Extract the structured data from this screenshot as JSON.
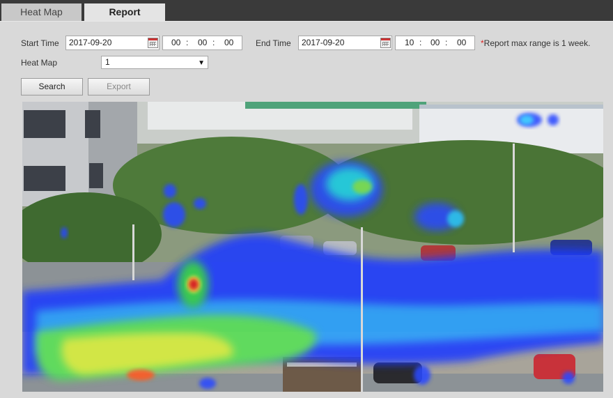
{
  "tabs": [
    {
      "label": "Heat Map",
      "active": false
    },
    {
      "label": "Report",
      "active": true
    }
  ],
  "form": {
    "start_time_label": "Start Time",
    "start_date": "2017-09-20",
    "start_hour": "00",
    "start_min": "00",
    "start_sec": "00",
    "end_time_label": "End Time",
    "end_date": "2017-09-20",
    "end_hour": "10",
    "end_min": "00",
    "end_sec": "00",
    "time_sep": ":",
    "note_star": "*",
    "note_text": "Report max range is 1 week.",
    "heatmap_label": "Heat Map",
    "heatmap_value": "1",
    "search_label": "Search",
    "export_label": "Export"
  },
  "icons": {
    "calendar": "calendar-icon",
    "dropdown": "chevron-down-icon"
  },
  "colors": {
    "tab_bar": "#3a3a3a",
    "panel_bg": "#d9d9d9",
    "note_star": "#dd2222",
    "heat_low": "#1a3cff",
    "heat_mid": "#2cc8ff",
    "heat_high": "#e02020"
  }
}
